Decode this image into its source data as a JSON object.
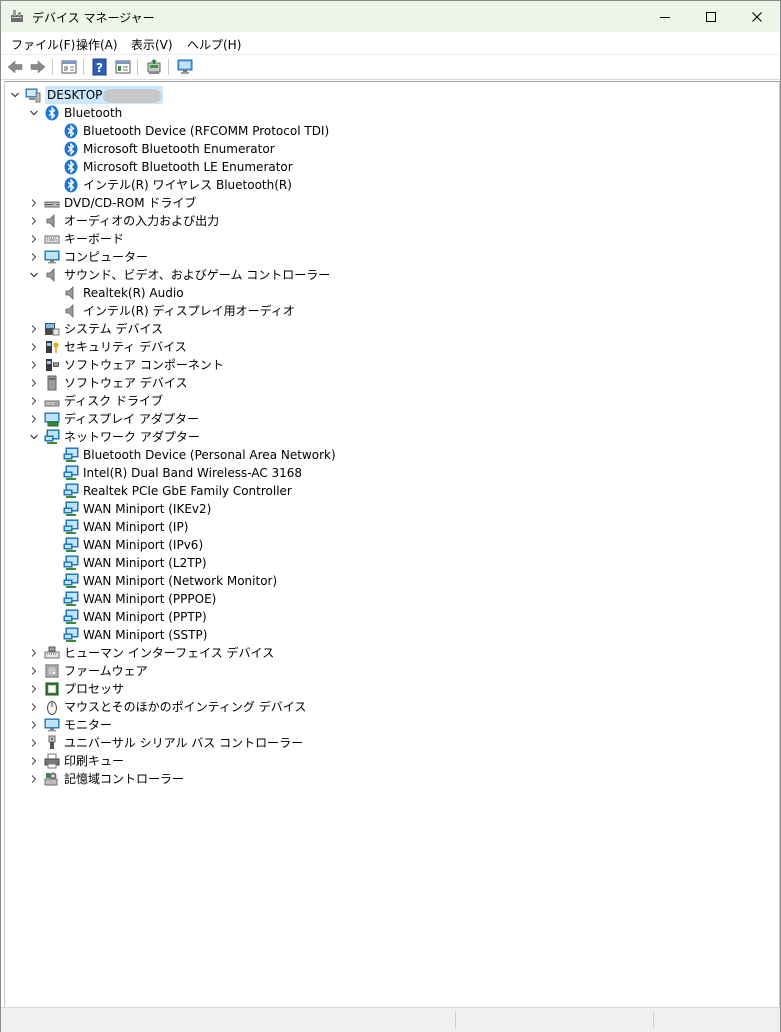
{
  "window": {
    "title": "デバイス マネージャー",
    "controls": {
      "minimize": "minimize",
      "maximize": "maximize",
      "close": "close"
    }
  },
  "menu": [
    "ファイル(F)",
    "操作(A)",
    "表示(V)",
    "ヘルプ(H)"
  ],
  "toolbar": [
    "back-icon",
    "forward-icon",
    "properties-view-icon",
    "help-icon",
    "action-view-icon",
    "update-driver-icon",
    "scan-hardware-icon"
  ],
  "tree": {
    "root": {
      "label": "DESKTOP",
      "expanded": true
    },
    "categories": [
      {
        "label": "Bluetooth",
        "icon": "bluetooth-icon",
        "expanded": true,
        "children": [
          "Bluetooth Device (RFCOMM Protocol TDI)",
          "Microsoft Bluetooth Enumerator",
          "Microsoft Bluetooth LE Enumerator",
          "インテル(R) ワイヤレス Bluetooth(R)"
        ]
      },
      {
        "label": "DVD/CD-ROM ドライブ",
        "icon": "dvd-drive-icon",
        "expanded": false,
        "children": []
      },
      {
        "label": "オーディオの入力および出力",
        "icon": "speaker-icon",
        "expanded": false,
        "children": []
      },
      {
        "label": "キーボード",
        "icon": "keyboard-icon",
        "expanded": false,
        "children": []
      },
      {
        "label": "コンピューター",
        "icon": "computer-icon",
        "expanded": false,
        "children": []
      },
      {
        "label": "サウンド、ビデオ、およびゲーム コントローラー",
        "icon": "speaker-icon",
        "expanded": true,
        "children": [
          "Realtek(R) Audio",
          "インテル(R) ディスプレイ用オーディオ"
        ]
      },
      {
        "label": "システム デバイス",
        "icon": "system-device-icon",
        "expanded": false,
        "children": []
      },
      {
        "label": "セキュリティ デバイス",
        "icon": "security-device-icon",
        "expanded": false,
        "children": []
      },
      {
        "label": "ソフトウェア コンポーネント",
        "icon": "software-component-icon",
        "expanded": false,
        "children": []
      },
      {
        "label": "ソフトウェア デバイス",
        "icon": "software-device-icon",
        "expanded": false,
        "children": []
      },
      {
        "label": "ディスク ドライブ",
        "icon": "disk-drive-icon",
        "expanded": false,
        "children": []
      },
      {
        "label": "ディスプレイ アダプター",
        "icon": "display-adapter-icon",
        "expanded": false,
        "children": []
      },
      {
        "label": "ネットワーク アダプター",
        "icon": "network-adapter-icon",
        "expanded": true,
        "children": [
          "Bluetooth Device (Personal Area Network)",
          "Intel(R) Dual Band Wireless-AC 3168",
          "Realtek PCIe GbE Family Controller",
          "WAN Miniport (IKEv2)",
          "WAN Miniport (IP)",
          "WAN Miniport (IPv6)",
          "WAN Miniport (L2TP)",
          "WAN Miniport (Network Monitor)",
          "WAN Miniport (PPPOE)",
          "WAN Miniport (PPTP)",
          "WAN Miniport (SSTP)"
        ]
      },
      {
        "label": "ヒューマン インターフェイス デバイス",
        "icon": "hid-icon",
        "expanded": false,
        "children": []
      },
      {
        "label": "ファームウェア",
        "icon": "firmware-icon",
        "expanded": false,
        "children": []
      },
      {
        "label": "プロセッサ",
        "icon": "processor-icon",
        "expanded": false,
        "children": []
      },
      {
        "label": "マウスとそのほかのポインティング デバイス",
        "icon": "mouse-icon",
        "expanded": false,
        "children": []
      },
      {
        "label": "モニター",
        "icon": "monitor-icon",
        "expanded": false,
        "children": []
      },
      {
        "label": "ユニバーサル シリアル バス コントローラー",
        "icon": "usb-icon",
        "expanded": false,
        "children": []
      },
      {
        "label": "印刷キュー",
        "icon": "printer-icon",
        "expanded": false,
        "children": []
      },
      {
        "label": "記憶域コントローラー",
        "icon": "storage-controller-icon",
        "expanded": false,
        "children": []
      }
    ]
  },
  "colors": {
    "titlebar": "#eef5e8",
    "selection": "#cce8ff",
    "bluetooth": "#1e74d2",
    "network": "#2a8fd6"
  }
}
